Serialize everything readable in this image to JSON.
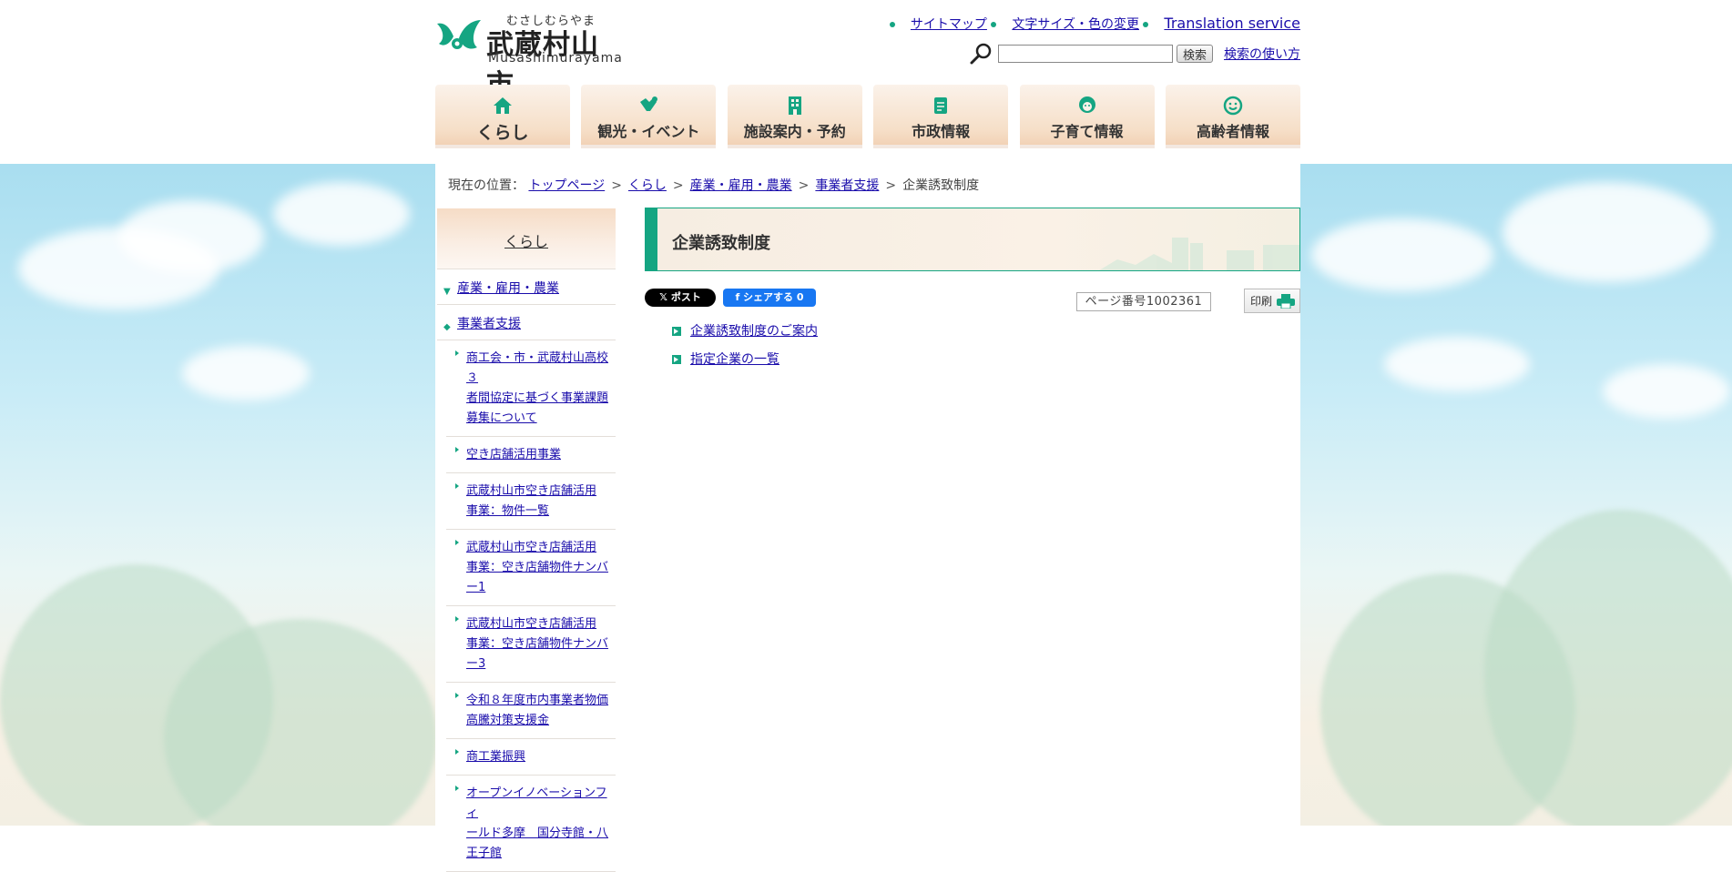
{
  "header": {
    "logo_kana": "むさしむらやま",
    "logo_name": "武蔵村山市",
    "logo_roman": "Musashimurayama",
    "links": {
      "sitemap": "サイトマップ",
      "font_color": "文字サイズ・色の変更",
      "translation": "Translation service"
    },
    "search": {
      "placeholder": "",
      "button_label": "検索",
      "help_label": "検索の使い方"
    }
  },
  "global_nav": [
    {
      "label": "くらし",
      "icon": "house-icon"
    },
    {
      "label": "観光・イベント",
      "icon": "handshake-icon"
    },
    {
      "label": "施設案内・予約",
      "icon": "building-icon"
    },
    {
      "label": "市政情報",
      "icon": "document-icon"
    },
    {
      "label": "子育て情報",
      "icon": "child-icon"
    },
    {
      "label": "高齢者情報",
      "icon": "elder-face-icon"
    }
  ],
  "breadcrumb": {
    "prefix": "現在の位置：",
    "items": [
      "トップページ",
      "くらし",
      "産業・雇用・農業",
      "事業者支援"
    ],
    "current": "企業誘致制度",
    "separator": ">"
  },
  "sidebar": {
    "heading": "くらし",
    "level1": [
      {
        "label": "産業・雇用・農業",
        "arrow": "down"
      },
      {
        "label": "事業者支援",
        "arrow": "diamond"
      }
    ],
    "level2": [
      {
        "lines": [
          "商工会・市・武蔵村山高校３",
          "者間協定に基づく事業課題",
          "募集について"
        ]
      },
      {
        "lines": [
          "空き店舗活用事業"
        ]
      },
      {
        "lines": [
          "武蔵村山市空き店舗活用",
          "事業：物件一覧"
        ]
      },
      {
        "lines": [
          "武蔵村山市空き店舗活用",
          "事業：空き店舗物件ナンバ",
          "ー1"
        ]
      },
      {
        "lines": [
          "武蔵村山市空き店舗活用",
          "事業：空き店舗物件ナンバ",
          "ー3"
        ]
      },
      {
        "lines": [
          "令和８年度市内事業者物価",
          "高騰対策支援金"
        ]
      },
      {
        "lines": [
          "商工業振興"
        ]
      },
      {
        "lines": [
          "オープンイノベーションフィ",
          "ールド多摩　国分寺館・八",
          "王子館"
        ]
      }
    ]
  },
  "main": {
    "title": "企業誘致制度",
    "share": {
      "x_label": "𝕏 ポスト",
      "fb_label": "f シェアする 0"
    },
    "page_number": "ページ番号1002361",
    "print_label": "印刷",
    "links": [
      "企業誘致制度のご案内",
      "指定企業の一覧"
    ]
  },
  "colors": {
    "accent": "#15a582",
    "nav_gradient_top": "#fbf2ea",
    "nav_gradient_bottom": "#f2d2b6",
    "link": "#1a0dab"
  }
}
